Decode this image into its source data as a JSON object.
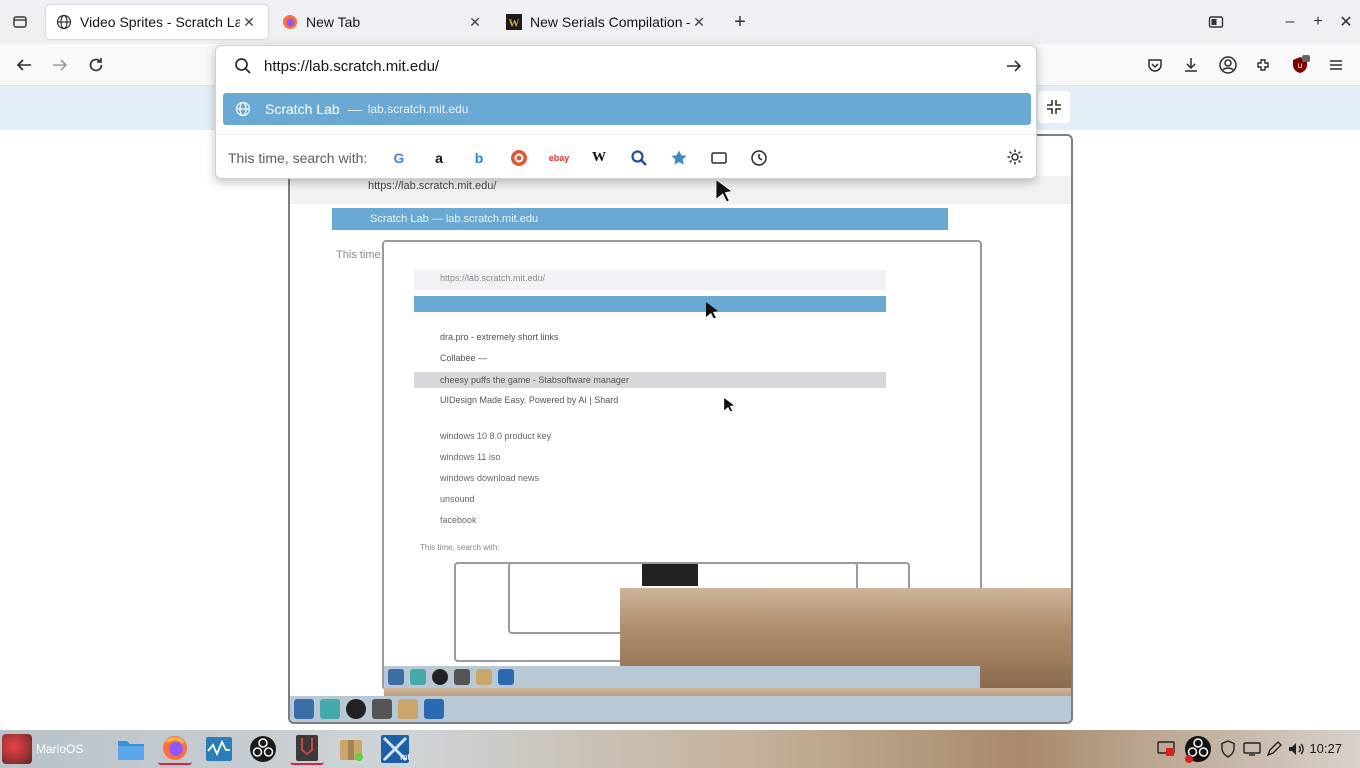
{
  "browser": {
    "tabs": [
      {
        "title": "Video Sprites - Scratch Lab",
        "active": true,
        "icon": "globe-icon"
      },
      {
        "title": "New Tab",
        "active": false,
        "icon": "firefox-icon"
      },
      {
        "title": "New Serials Compilation — ",
        "active": false,
        "icon": "w-logo-icon"
      }
    ],
    "new_tab_symbol": "+",
    "close_symbol": "✕",
    "window_controls": {
      "minimize": "–",
      "maximize": "+",
      "close": "✕"
    }
  },
  "urlbar": {
    "value": "https://lab.scratch.mit.edu/",
    "suggestion_title": "Scratch Lab",
    "suggestion_sep": "—",
    "suggestion_url": "lab.scratch.mit.edu",
    "oneoff_label": "This time, search with:",
    "engines": [
      "google-icon",
      "amazon-icon",
      "bing-icon",
      "duckduckgo-icon",
      "ebay-icon",
      "wikipedia-icon",
      "search-icon",
      "bookmark-star-icon",
      "tabs-icon",
      "history-icon"
    ],
    "engine_glyphs": {
      "google": "G",
      "amazon": "a",
      "bing": "b",
      "wikipedia": "W",
      "ebay": "ebay"
    }
  },
  "preview": {
    "nested_url": "https://lab.scratch.mit.edu/",
    "nested_suggestion": "Scratch Lab — lab.scratch.mit.edu",
    "nested_oneoff": "This time, search with:",
    "history_items": [
      "dra.pro - extremely short links",
      "Collabee — ",
      "cheesy puffs the game - Stabsoftware manager",
      "UIDesign Made Easy. Powered by AI | Shard"
    ],
    "recent_searches": [
      "windows 10 8.0 product key",
      "windows 11 iso",
      "windows download news",
      "unsound",
      "facebook"
    ]
  },
  "taskbar": {
    "start_label": "MarioOS",
    "clock": "10:27",
    "apps": [
      "files-icon",
      "firefox-icon",
      "system-monitor-icon",
      "obs-icon",
      "terminal-icon",
      "archive-icon",
      "mt-app-icon"
    ],
    "tray": [
      "screen-share-icon",
      "obs-tray-icon",
      "shield-icon",
      "display-icon",
      "pen-icon",
      "volume-icon"
    ]
  },
  "colors": {
    "accent": "#6aa9d3",
    "tabstrip": "#f0f0f4",
    "navbar": "#f9f9fb"
  }
}
